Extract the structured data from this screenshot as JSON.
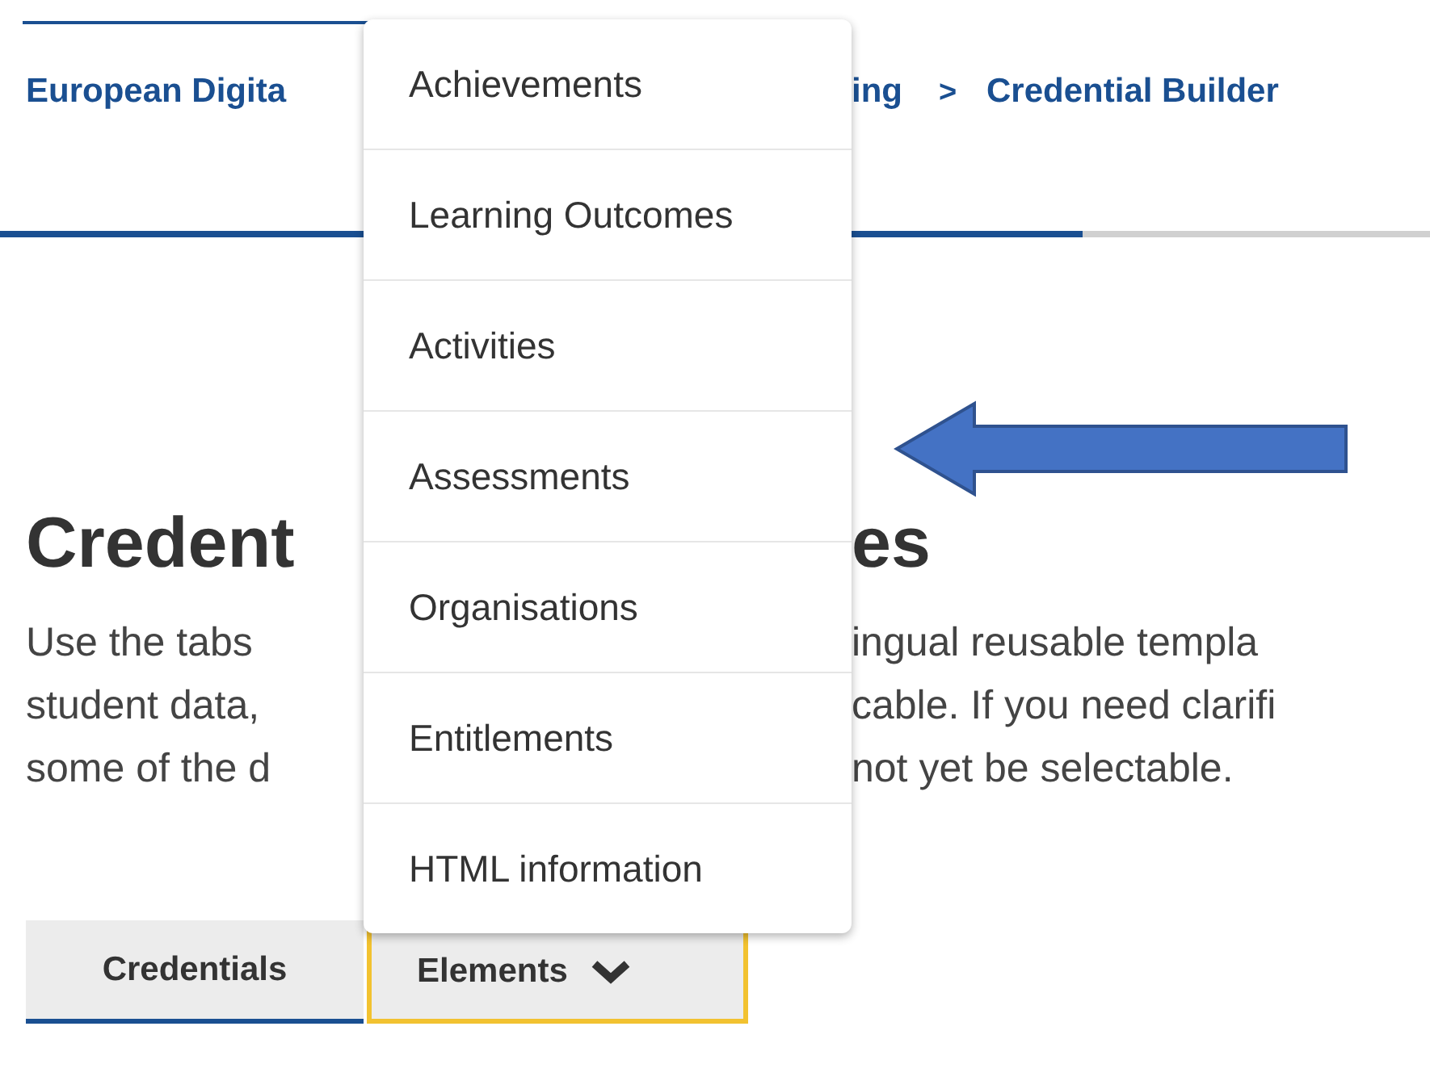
{
  "breadcrumb": {
    "first": "European Digita",
    "second": "ing",
    "separator": ">",
    "current": "Credential Builder"
  },
  "progress": {
    "level": 0.757
  },
  "heading": {
    "left": "Credent",
    "right": "es"
  },
  "intro_lines": [
    {
      "left": "Use the tabs",
      "right": "ingual reusable templa"
    },
    {
      "left": "student data,",
      "right": "cable. If you need clarifi"
    },
    {
      "left": "some of the d",
      "right": "not yet be selectable."
    }
  ],
  "menu": {
    "items": [
      "Achievements",
      "Learning Outcomes",
      "Activities",
      "Assessments",
      "Organisations",
      "Entitlements",
      "HTML information"
    ]
  },
  "tabs": [
    {
      "label": "Credentials",
      "selected": true,
      "kind": "tab",
      "focused": false
    },
    {
      "label": "Elements",
      "selected": false,
      "kind": "dropdown",
      "focused": true,
      "expanded": true
    }
  ]
}
